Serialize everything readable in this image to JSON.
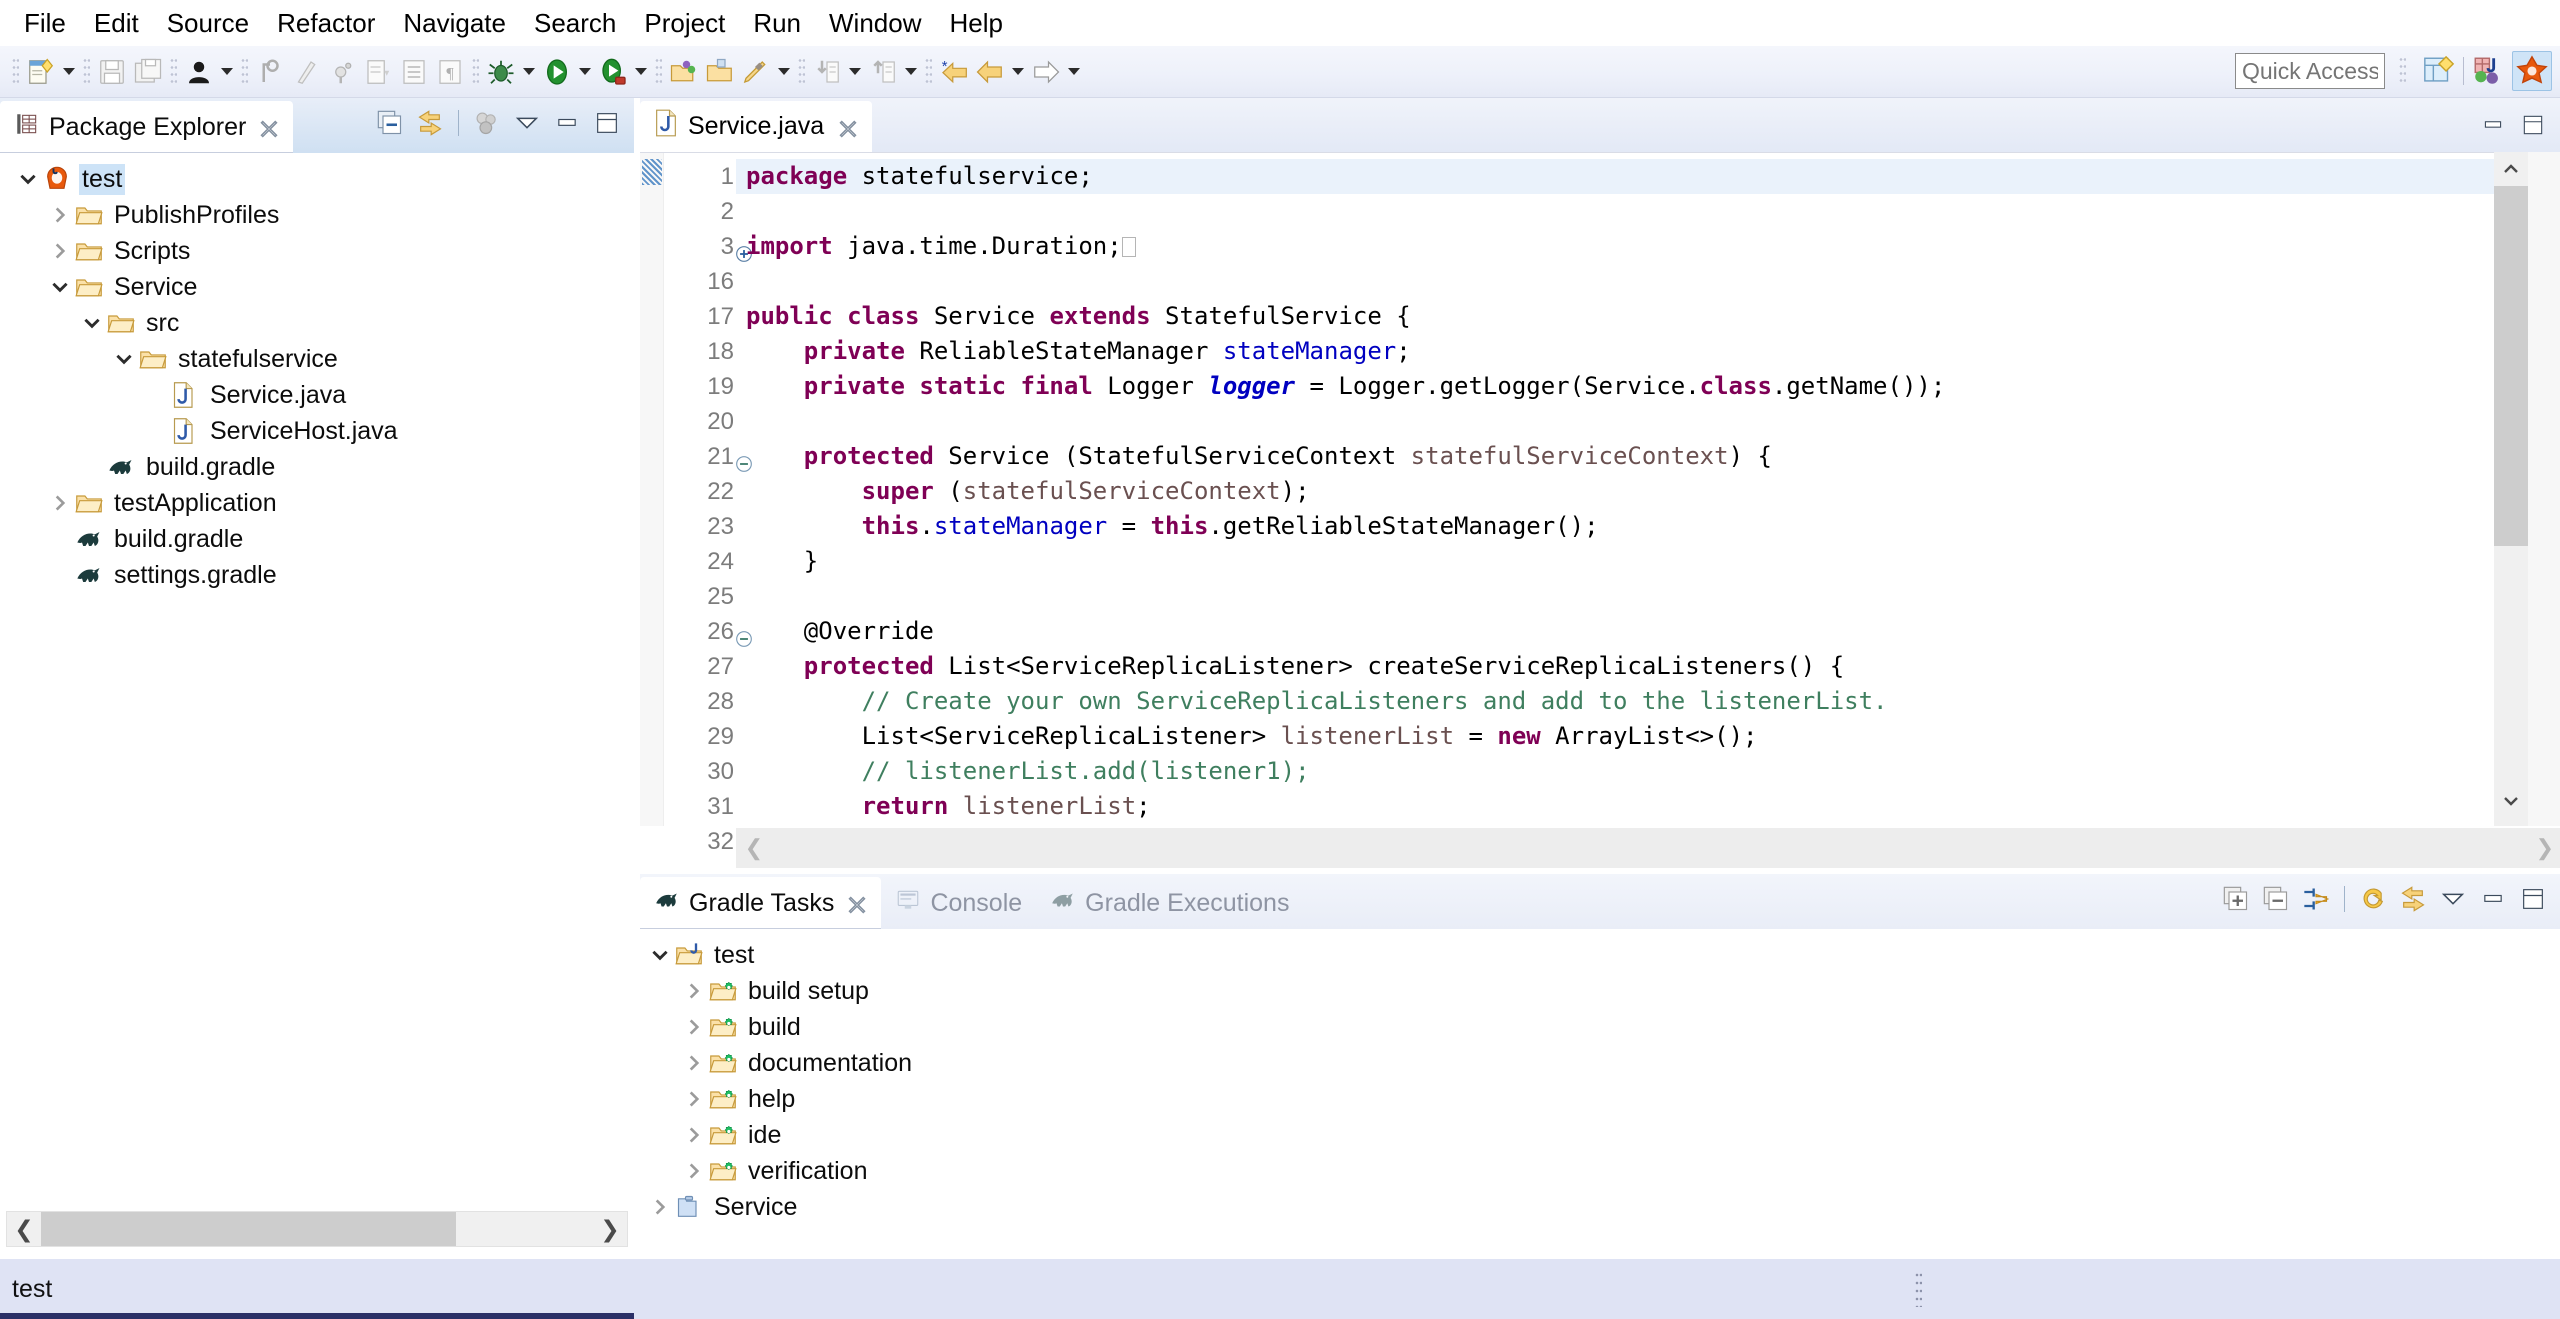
{
  "menu": {
    "items": [
      "File",
      "Edit",
      "Source",
      "Refactor",
      "Navigate",
      "Search",
      "Project",
      "Run",
      "Window",
      "Help"
    ]
  },
  "toolbar": {
    "quick_access_placeholder": "Quick Access",
    "buttons": [
      {
        "name": "new-wizard",
        "icon": "new-file-icon"
      },
      {
        "name": "save",
        "icon": "save-icon"
      },
      {
        "name": "save-all",
        "icon": "save-all-icon"
      },
      {
        "name": "person",
        "icon": "person-icon"
      },
      {
        "name": "toggle-mark-occurrences",
        "icon": "mark-occurrences-icon"
      },
      {
        "name": "skip-breakpoints",
        "icon": "skip-breakpoints-icon"
      },
      {
        "name": "new-java-package",
        "icon": "new-package-icon"
      },
      {
        "name": "new-java-class",
        "icon": "new-class-icon"
      },
      {
        "name": "open-task",
        "icon": "task-icon"
      },
      {
        "name": "show-whitespace",
        "icon": "pilcrow-icon"
      },
      {
        "name": "debug",
        "icon": "bug-icon"
      },
      {
        "name": "run",
        "icon": "run-icon"
      },
      {
        "name": "coverage",
        "icon": "coverage-icon"
      },
      {
        "name": "new-java-project",
        "icon": "open-folder-icon"
      },
      {
        "name": "open-type",
        "icon": "open-type-icon"
      },
      {
        "name": "search",
        "icon": "pencil-icon"
      },
      {
        "name": "import",
        "icon": "import-icon"
      },
      {
        "name": "export",
        "icon": "export-icon"
      },
      {
        "name": "back-marked",
        "icon": "back-star-icon"
      },
      {
        "name": "back",
        "icon": "back-icon"
      },
      {
        "name": "forward",
        "icon": "forward-icon"
      }
    ],
    "perspective": [
      {
        "name": "open-perspective",
        "icon": "open-perspective-icon"
      },
      {
        "name": "java-perspective",
        "icon": "java-perspective-icon"
      },
      {
        "name": "gradle-perspective",
        "icon": "gradle-perspective-icon"
      }
    ]
  },
  "package_explorer": {
    "tab_label": "Package Explorer",
    "tab_icon": "package-explorer-icon",
    "toolbar": [
      {
        "name": "collapse-all",
        "icon": "collapse-all-icon"
      },
      {
        "name": "link-with-editor",
        "icon": "link-editor-icon"
      },
      {
        "name": "focus-on-active-task",
        "icon": "focus-task-icon"
      },
      {
        "name": "view-menu",
        "icon": "view-menu-icon"
      },
      {
        "name": "minimize",
        "icon": "minimize-icon"
      },
      {
        "name": "maximize",
        "icon": "maximize-icon"
      }
    ],
    "tree": [
      {
        "label": "test",
        "depth": 0,
        "twisty": "down",
        "icon": "java-project-icon",
        "selected": true
      },
      {
        "label": "PublishProfiles",
        "depth": 1,
        "twisty": "right",
        "icon": "folder-icon",
        "selected": false
      },
      {
        "label": "Scripts",
        "depth": 1,
        "twisty": "right",
        "icon": "folder-icon",
        "selected": false
      },
      {
        "label": "Service",
        "depth": 1,
        "twisty": "down",
        "icon": "folder-icon",
        "selected": false
      },
      {
        "label": "src",
        "depth": 2,
        "twisty": "down",
        "icon": "folder-icon",
        "selected": false
      },
      {
        "label": "statefulservice",
        "depth": 3,
        "twisty": "down",
        "icon": "folder-icon",
        "selected": false
      },
      {
        "label": "Service.java",
        "depth": 4,
        "twisty": "none",
        "icon": "java-file-icon",
        "selected": false
      },
      {
        "label": "ServiceHost.java",
        "depth": 4,
        "twisty": "none",
        "icon": "java-file-icon",
        "selected": false
      },
      {
        "label": "build.gradle",
        "depth": 2,
        "twisty": "none",
        "icon": "gradle-icon",
        "selected": false
      },
      {
        "label": "testApplication",
        "depth": 1,
        "twisty": "right",
        "icon": "folder-icon",
        "selected": false
      },
      {
        "label": "build.gradle",
        "depth": 1,
        "twisty": "none",
        "icon": "gradle-icon",
        "selected": false
      },
      {
        "label": "settings.gradle",
        "depth": 1,
        "twisty": "none",
        "icon": "gradle-icon",
        "selected": false
      }
    ]
  },
  "editor": {
    "tab_label": "Service.java",
    "tab_icon": "java-file-icon",
    "win_buttons": [
      {
        "name": "minimize",
        "icon": "minimize-icon"
      },
      {
        "name": "maximize",
        "icon": "maximize-icon"
      }
    ],
    "lines": [
      {
        "n": "1",
        "fold": "none",
        "highlight": true,
        "marker": true,
        "tokens": [
          {
            "t": "package",
            "c": "kw"
          },
          {
            "t": " statefulservice;",
            "c": ""
          }
        ]
      },
      {
        "n": "2",
        "fold": "none",
        "highlight": false,
        "marker": false,
        "tokens": []
      },
      {
        "n": "3",
        "fold": "plus",
        "highlight": false,
        "marker": false,
        "tokens": [
          {
            "t": "import",
            "c": "kw"
          },
          {
            "t": " java.time.Duration;",
            "c": ""
          },
          {
            "t": "□",
            "c": "ph"
          }
        ]
      },
      {
        "n": "16",
        "fold": "none",
        "highlight": false,
        "marker": false,
        "tokens": []
      },
      {
        "n": "17",
        "fold": "none",
        "highlight": false,
        "marker": false,
        "tokens": [
          {
            "t": "public class",
            "c": "kw"
          },
          {
            "t": " Service ",
            "c": ""
          },
          {
            "t": "extends",
            "c": "kw"
          },
          {
            "t": " StatefulService {",
            "c": ""
          }
        ]
      },
      {
        "n": "18",
        "fold": "none",
        "highlight": false,
        "marker": false,
        "tokens": [
          {
            "t": "    ",
            "c": ""
          },
          {
            "t": "private",
            "c": "kw"
          },
          {
            "t": " ReliableStateManager ",
            "c": ""
          },
          {
            "t": "stateManager",
            "c": "fld"
          },
          {
            "t": ";",
            "c": ""
          }
        ]
      },
      {
        "n": "19",
        "fold": "none",
        "highlight": false,
        "marker": false,
        "tokens": [
          {
            "t": "    ",
            "c": ""
          },
          {
            "t": "private static final",
            "c": "kw"
          },
          {
            "t": " Logger ",
            "c": ""
          },
          {
            "t": "logger",
            "c": "fld-i"
          },
          {
            "t": " = Logger.getLogger(Service.",
            "c": ""
          },
          {
            "t": "class",
            "c": "kw"
          },
          {
            "t": ".getName());",
            "c": ""
          }
        ]
      },
      {
        "n": "20",
        "fold": "none",
        "highlight": false,
        "marker": false,
        "tokens": []
      },
      {
        "n": "21",
        "fold": "minus",
        "highlight": false,
        "marker": false,
        "tokens": [
          {
            "t": "    ",
            "c": ""
          },
          {
            "t": "protected",
            "c": "kw"
          },
          {
            "t": " Service (StatefulServiceContext ",
            "c": ""
          },
          {
            "t": "statefulServiceContext",
            "c": "par"
          },
          {
            "t": ") {",
            "c": ""
          }
        ]
      },
      {
        "n": "22",
        "fold": "none",
        "highlight": false,
        "marker": false,
        "tokens": [
          {
            "t": "        ",
            "c": ""
          },
          {
            "t": "super",
            "c": "kw"
          },
          {
            "t": " (",
            "c": ""
          },
          {
            "t": "statefulServiceContext",
            "c": "par"
          },
          {
            "t": ");",
            "c": ""
          }
        ]
      },
      {
        "n": "23",
        "fold": "none",
        "highlight": false,
        "marker": false,
        "tokens": [
          {
            "t": "        ",
            "c": ""
          },
          {
            "t": "this",
            "c": "kw"
          },
          {
            "t": ".",
            "c": ""
          },
          {
            "t": "stateManager",
            "c": "fld"
          },
          {
            "t": " = ",
            "c": ""
          },
          {
            "t": "this",
            "c": "kw"
          },
          {
            "t": ".getReliableStateManager();",
            "c": ""
          }
        ]
      },
      {
        "n": "24",
        "fold": "none",
        "highlight": false,
        "marker": false,
        "tokens": [
          {
            "t": "    }",
            "c": ""
          }
        ]
      },
      {
        "n": "25",
        "fold": "none",
        "highlight": false,
        "marker": false,
        "tokens": []
      },
      {
        "n": "26",
        "fold": "minus",
        "highlight": false,
        "marker": false,
        "tokens": [
          {
            "t": "    @Override",
            "c": ""
          }
        ]
      },
      {
        "n": "27",
        "fold": "none",
        "highlight": false,
        "marker": false,
        "tokens": [
          {
            "t": "    ",
            "c": ""
          },
          {
            "t": "protected",
            "c": "kw"
          },
          {
            "t": " List<ServiceReplicaListener> createServiceReplicaListeners() {",
            "c": ""
          }
        ]
      },
      {
        "n": "28",
        "fold": "none",
        "highlight": false,
        "marker": false,
        "tokens": [
          {
            "t": "        ",
            "c": ""
          },
          {
            "t": "// Create your own ServiceReplicaListeners and add to the listenerList.",
            "c": "cmt"
          }
        ]
      },
      {
        "n": "29",
        "fold": "none",
        "highlight": false,
        "marker": false,
        "tokens": [
          {
            "t": "        List<ServiceReplicaListener> ",
            "c": ""
          },
          {
            "t": "listenerList",
            "c": "par"
          },
          {
            "t": " = ",
            "c": ""
          },
          {
            "t": "new",
            "c": "kw"
          },
          {
            "t": " ArrayList<>();",
            "c": ""
          }
        ]
      },
      {
        "n": "30",
        "fold": "none",
        "highlight": false,
        "marker": false,
        "tokens": [
          {
            "t": "        ",
            "c": ""
          },
          {
            "t": "// listenerList.add(listener1);",
            "c": "cmt"
          }
        ]
      },
      {
        "n": "31",
        "fold": "none",
        "highlight": false,
        "marker": false,
        "tokens": [
          {
            "t": "        ",
            "c": ""
          },
          {
            "t": "return",
            "c": "kw"
          },
          {
            "t": " ",
            "c": ""
          },
          {
            "t": "listenerList",
            "c": "par"
          },
          {
            "t": ";",
            "c": ""
          }
        ]
      },
      {
        "n": "32",
        "fold": "none",
        "highlight": false,
        "marker": false,
        "tokens": [
          {
            "t": "    }",
            "c": ""
          }
        ]
      }
    ]
  },
  "bottom_view": {
    "tabs": [
      {
        "label": "Gradle Tasks",
        "icon": "gradle-icon",
        "active": true,
        "closable": true
      },
      {
        "label": "Console",
        "icon": "console-icon",
        "active": false,
        "closable": false
      },
      {
        "label": "Gradle Executions",
        "icon": "gradle-icon",
        "active": false,
        "closable": false
      }
    ],
    "toolbar": [
      {
        "name": "expand-all",
        "icon": "expand-all-icon"
      },
      {
        "name": "collapse-all",
        "icon": "collapse-all-icon"
      },
      {
        "name": "toggle-grouping",
        "icon": "grouping-icon"
      },
      {
        "name": "refresh",
        "icon": "refresh-icon"
      },
      {
        "name": "link-with-selection",
        "icon": "link-editor-icon"
      },
      {
        "name": "view-menu",
        "icon": "view-menu-icon"
      },
      {
        "name": "minimize",
        "icon": "minimize-icon"
      },
      {
        "name": "maximize",
        "icon": "maximize-icon"
      }
    ],
    "tree": [
      {
        "label": "test",
        "depth": 0,
        "twisty": "down",
        "icon": "gradle-project-icon"
      },
      {
        "label": "build setup",
        "depth": 1,
        "twisty": "right",
        "icon": "task-group-icon"
      },
      {
        "label": "build",
        "depth": 1,
        "twisty": "right",
        "icon": "task-group-icon"
      },
      {
        "label": "documentation",
        "depth": 1,
        "twisty": "right",
        "icon": "task-group-icon"
      },
      {
        "label": "help",
        "depth": 1,
        "twisty": "right",
        "icon": "task-group-icon"
      },
      {
        "label": "ide",
        "depth": 1,
        "twisty": "right",
        "icon": "task-group-icon"
      },
      {
        "label": "verification",
        "depth": 1,
        "twisty": "right",
        "icon": "task-group-icon"
      },
      {
        "label": "Service",
        "depth": 0,
        "twisty": "right",
        "icon": "blue-folder-icon"
      }
    ]
  },
  "statusbar": {
    "text": "test"
  },
  "colors": {
    "keyword": "#7f0055",
    "field": "#0000c0",
    "comment": "#3f7f5f",
    "parameter": "#6a5050",
    "selection": "#cde3f7",
    "line_highlight": "#eaf2fb",
    "statusbar_bg": "#dfe3f4",
    "tab_active_bg": "#ffffff"
  }
}
